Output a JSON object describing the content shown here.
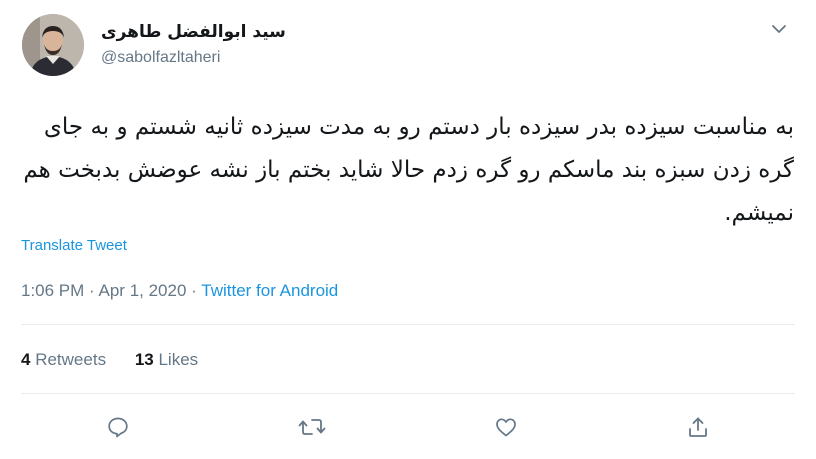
{
  "user": {
    "display_name": "سید ابوالفضل طاهری",
    "handle": "@sabolfazltaheri",
    "avatar_icon": "profile-photo"
  },
  "tweet": {
    "text": "به مناسبت سیزده بدر سیزده بار دستم رو به مدت سیزده ثانیه شستم و به جای گره زدن سبزه بند ماسکم رو گره زدم حالا شاید بختم باز نشه عوضش بدبخت هم نمیشم.",
    "translate_label": "Translate Tweet",
    "time": "1:06 PM",
    "date": "Apr 1, 2020",
    "separator": "·",
    "source": "Twitter for Android"
  },
  "stats": {
    "retweets_count": "4",
    "retweets_label": "Retweets",
    "likes_count": "13",
    "likes_label": "Likes"
  },
  "icons": {
    "reply": "reply-icon",
    "retweet": "retweet-icon",
    "like": "heart-icon",
    "share": "share-icon",
    "menu": "chevron-down-icon"
  },
  "colors": {
    "link": "#1b95e0",
    "muted": "#657786",
    "text": "#14171a",
    "divider": "#e6ecf0"
  }
}
